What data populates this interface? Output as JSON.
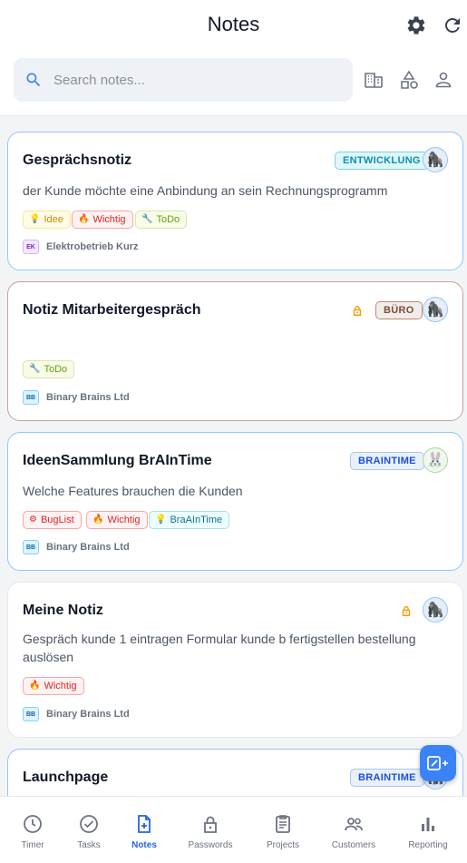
{
  "header": {
    "title": "Notes",
    "settings_icon": "gear-icon",
    "refresh_icon": "refresh-icon"
  },
  "search": {
    "placeholder": "Search notes...",
    "value": ""
  },
  "filters": [
    {
      "icon": "building-icon"
    },
    {
      "icon": "shapes-icon"
    },
    {
      "icon": "person-icon"
    }
  ],
  "notes": [
    {
      "title": "Gesprächsnotiz",
      "text": "der Kunde möchte eine Anbindung an sein Rechnungsprogramm",
      "category": "ENTWICKLUNG",
      "locked": false,
      "avatar": "gorilla",
      "tags": [
        {
          "label": "Idee",
          "icon": "lightbulb-icon"
        },
        {
          "label": "Wichtig",
          "icon": "flame-icon"
        },
        {
          "label": "ToDo",
          "icon": "wrench-icon"
        }
      ],
      "company_abbr": "EK",
      "company": "Elektrobetrieb Kurz"
    },
    {
      "title": "Notiz Mitarbeitergespräch",
      "text": "",
      "category": "BÜRO",
      "locked": true,
      "avatar": "gorilla",
      "tags": [
        {
          "label": "ToDo",
          "icon": "wrench-icon"
        }
      ],
      "company_abbr": "BB",
      "company": "Binary Brains Ltd"
    },
    {
      "title": "IdeenSammlung BrAInTime",
      "text": "Welche Features brauchen die Kunden",
      "category": "BRAINTIME",
      "locked": false,
      "avatar": "rabbit",
      "tags": [
        {
          "label": "BugList",
          "icon": "bug-icon"
        },
        {
          "label": "Wichtig",
          "icon": "flame-icon"
        },
        {
          "label": "BraAInTime",
          "icon": "bulb-icon"
        }
      ],
      "company_abbr": "BB",
      "company": "Binary Brains Ltd"
    },
    {
      "title": "Meine Notiz",
      "text": "Gespräch kunde 1 eintragen Formular kunde b fertigstellen bestellung auslösen",
      "category": "",
      "locked": true,
      "avatar": "gorilla",
      "tags": [
        {
          "label": "Wichtig",
          "icon": "flame-icon"
        }
      ],
      "company_abbr": "BB",
      "company": "Binary Brains Ltd"
    },
    {
      "title": "Launchpage",
      "category": "BRAINTIME",
      "avatar": "gorilla"
    }
  ],
  "fab": {
    "icon": "new-note-icon"
  },
  "nav": [
    {
      "label": "Timer",
      "icon": "clock-icon"
    },
    {
      "label": "Tasks",
      "icon": "check-circle-icon"
    },
    {
      "label": "Notes",
      "icon": "note-add-icon",
      "active": true
    },
    {
      "label": "Passwords",
      "icon": "lock-icon"
    },
    {
      "label": "Projects",
      "icon": "clipboard-icon"
    },
    {
      "label": "Customers",
      "icon": "people-icon"
    },
    {
      "label": "Reporting",
      "icon": "bar-chart-icon"
    }
  ],
  "colors": {
    "accent": "#2563eb",
    "card_border_blue": "#93c5fd",
    "card_border_brown": "#c4a39a"
  }
}
